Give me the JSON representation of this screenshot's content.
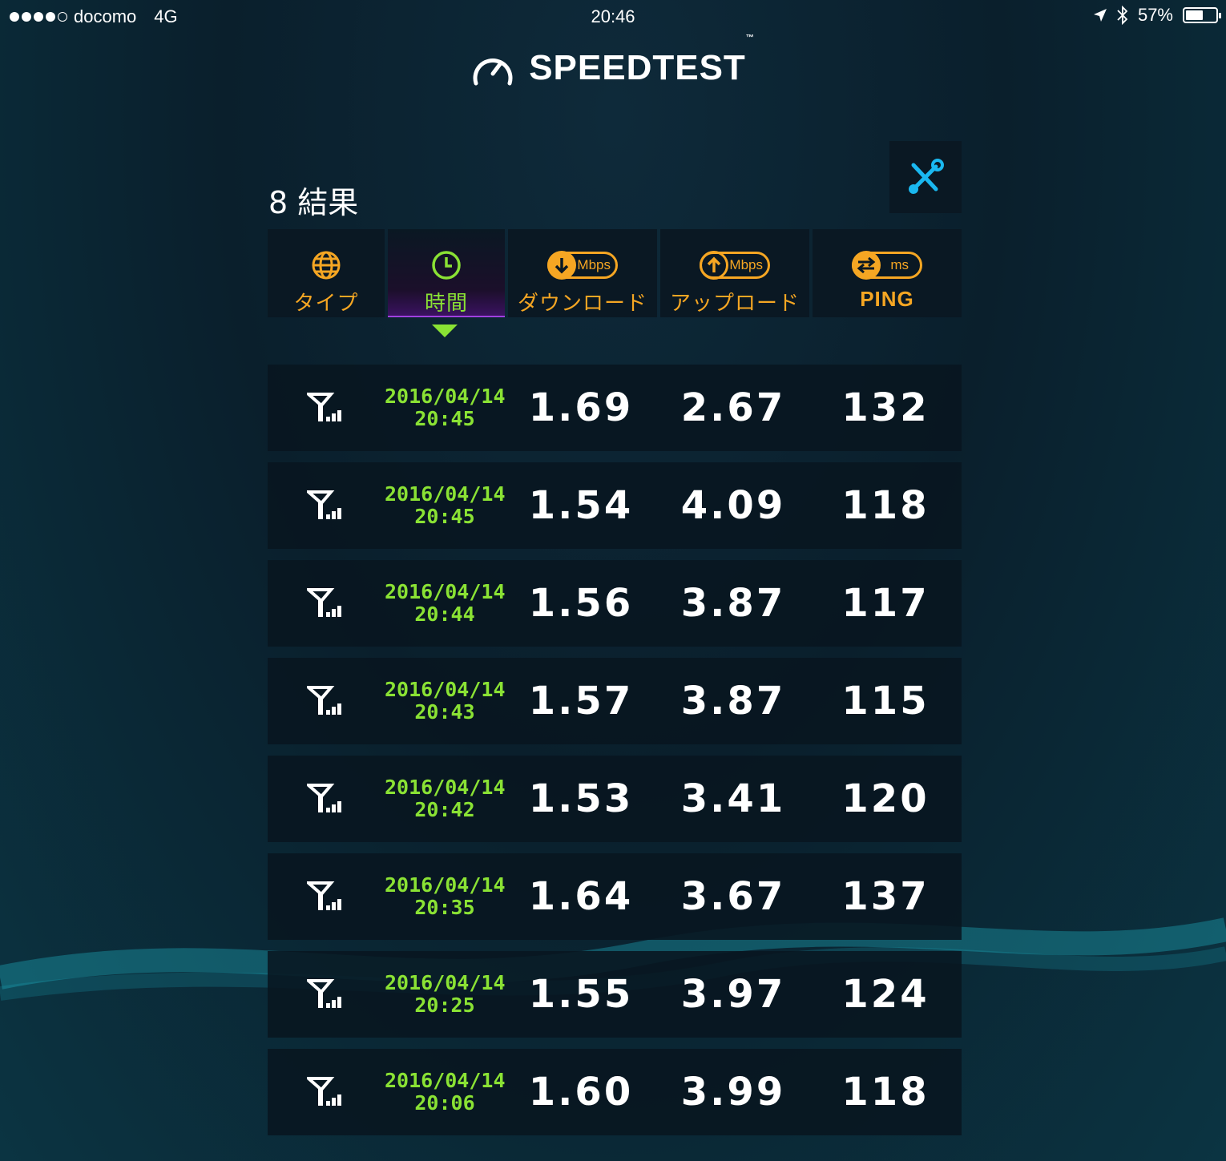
{
  "status": {
    "carrier": "docomo",
    "network": "4G",
    "time": "20:46",
    "battery": "57%",
    "battery_level": 0.57,
    "signal_bars": 4
  },
  "app": {
    "title": "SPEEDTEST",
    "trademark": "™"
  },
  "results_count_label": "8 結果",
  "headers": {
    "type": "タイプ",
    "time": "時間",
    "download": "ダウンロード",
    "download_unit": "Mbps",
    "upload": "アップロード",
    "upload_unit": "Mbps",
    "ping": "PING",
    "ping_unit": "ms"
  },
  "colors": {
    "accent_orange": "#f5a623",
    "accent_green": "#8ae234",
    "settings_icon": "#1ab8f0"
  },
  "rows": [
    {
      "date": "2016/04/14",
      "time": "20:45",
      "download": "1.69",
      "upload": "2.67",
      "ping": "132"
    },
    {
      "date": "2016/04/14",
      "time": "20:45",
      "download": "1.54",
      "upload": "4.09",
      "ping": "118"
    },
    {
      "date": "2016/04/14",
      "time": "20:44",
      "download": "1.56",
      "upload": "3.87",
      "ping": "117"
    },
    {
      "date": "2016/04/14",
      "time": "20:43",
      "download": "1.57",
      "upload": "3.87",
      "ping": "115"
    },
    {
      "date": "2016/04/14",
      "time": "20:42",
      "download": "1.53",
      "upload": "3.41",
      "ping": "120"
    },
    {
      "date": "2016/04/14",
      "time": "20:35",
      "download": "1.64",
      "upload": "3.67",
      "ping": "137"
    },
    {
      "date": "2016/04/14",
      "time": "20:25",
      "download": "1.55",
      "upload": "3.97",
      "ping": "124"
    },
    {
      "date": "2016/04/14",
      "time": "20:06",
      "download": "1.60",
      "upload": "3.99",
      "ping": "118"
    }
  ]
}
